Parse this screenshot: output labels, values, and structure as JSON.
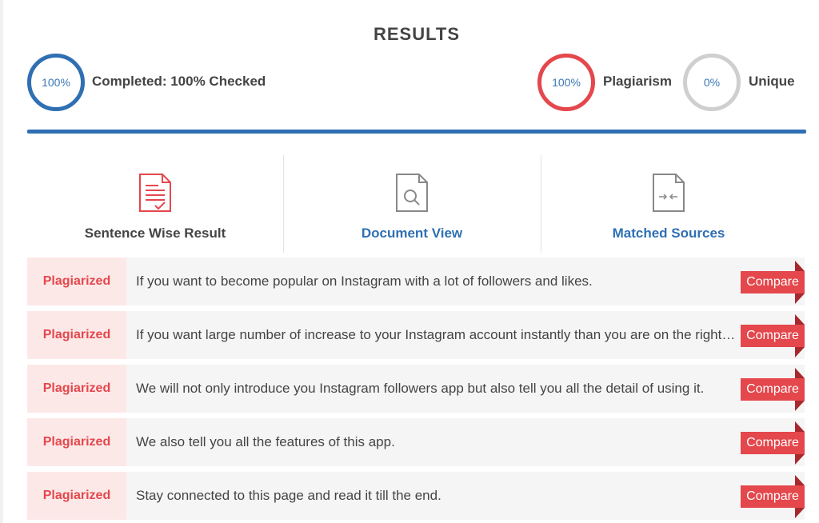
{
  "header": {
    "title": "RESULTS"
  },
  "stats": {
    "completed": {
      "value": "100%",
      "label": "Completed: 100% Checked"
    },
    "plagiarism": {
      "value": "100%",
      "label": "Plagiarism"
    },
    "unique": {
      "value": "0%",
      "label": "Unique"
    }
  },
  "tabs": [
    {
      "label": "Sentence Wise Result",
      "icon": "sentence-report-icon",
      "color": "#444444"
    },
    {
      "label": "Document View",
      "icon": "document-search-icon",
      "color": "#2f6fb3"
    },
    {
      "label": "Matched Sources",
      "icon": "document-compare-icon",
      "color": "#2f6fb3"
    }
  ],
  "results": [
    {
      "status": "Plagiarized",
      "sentence": "If you want to become popular on Instagram with a lot of followers and likes.",
      "action": "Compare"
    },
    {
      "status": "Plagiarized",
      "sentence": "If you want large number of increase to your Instagram account instantly than you are on the right place.",
      "action": "Compare"
    },
    {
      "status": "Plagiarized",
      "sentence": "We will not only introduce you Instagram followers app but also tell you all the detail of using it.",
      "action": "Compare"
    },
    {
      "status": "Plagiarized",
      "sentence": "We also tell you all the features of this app.",
      "action": "Compare"
    },
    {
      "status": "Plagiarized",
      "sentence": "Stay connected to this page and read it till the end.",
      "action": "Compare"
    }
  ],
  "colors": {
    "primary": "#2f6fb3",
    "danger": "#e4474c",
    "neutral": "#cfcfcf"
  }
}
